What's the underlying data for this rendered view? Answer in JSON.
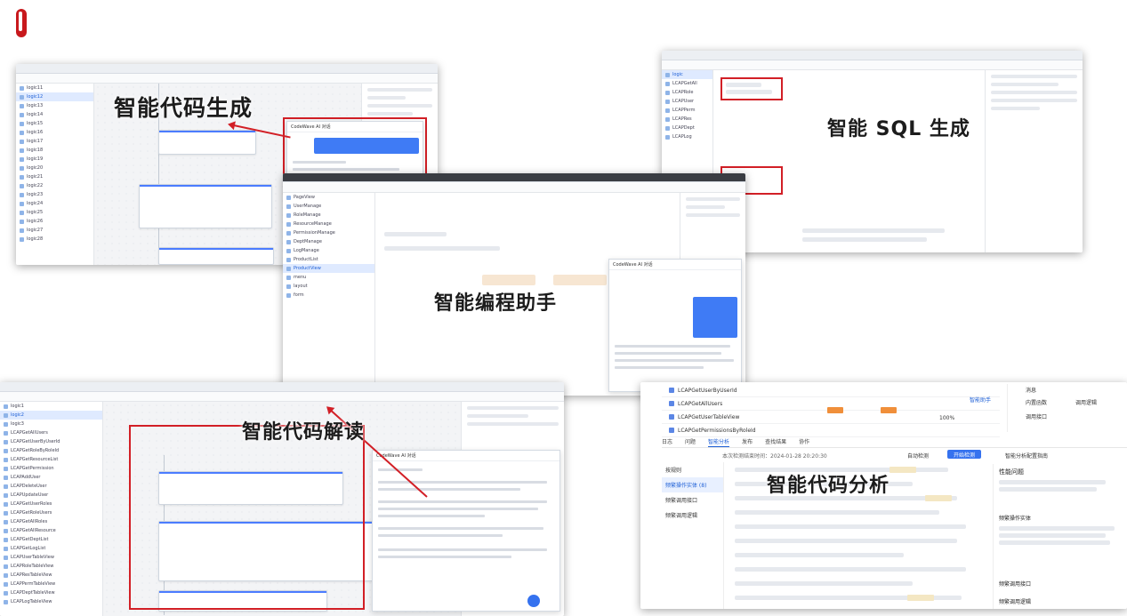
{
  "captions": {
    "code_gen": "智能代码生成",
    "sql_gen": "智能 SQL 生成",
    "assistant": "智能编程助手",
    "code_read": "智能代码解读",
    "code_analysis": "智能代码分析"
  },
  "chat": {
    "title": "CodeWave AI 对话",
    "assistant_name": "CodeWave AI"
  },
  "analysis_panel": {
    "tabs": [
      "日志",
      "问题",
      "智能分析",
      "发布",
      "查找结果",
      "协作"
    ],
    "check_button": "开始检测",
    "auto_check": "自动检测",
    "guide_link": "智能分析配置指南",
    "timestamp_text": "本次检测结束时间：2024-01-28 20:20:30",
    "left_menu": [
      "按规则",
      "频繁操作实体 (8)",
      "频繁调用接口",
      "频繁调用逻辑"
    ],
    "rows": [
      "LCAPGetUserByUserId",
      "LCAPGetAllUsers",
      "LCAPGetUserTableView",
      "LCAPGetPermissionsByRoleId"
    ],
    "right_title": "性能问题",
    "right_sections": [
      "频繁操作实体",
      "频繁调用接口",
      "频繁调用逻辑"
    ],
    "side_items": [
      "消息",
      "调用逻辑",
      "调用接口",
      "内置函数"
    ],
    "zoom": "100%",
    "smart_assistant": "智能助手"
  },
  "colors": {
    "highlight_red": "#d21f26",
    "brand_blue": "#3572ef"
  }
}
